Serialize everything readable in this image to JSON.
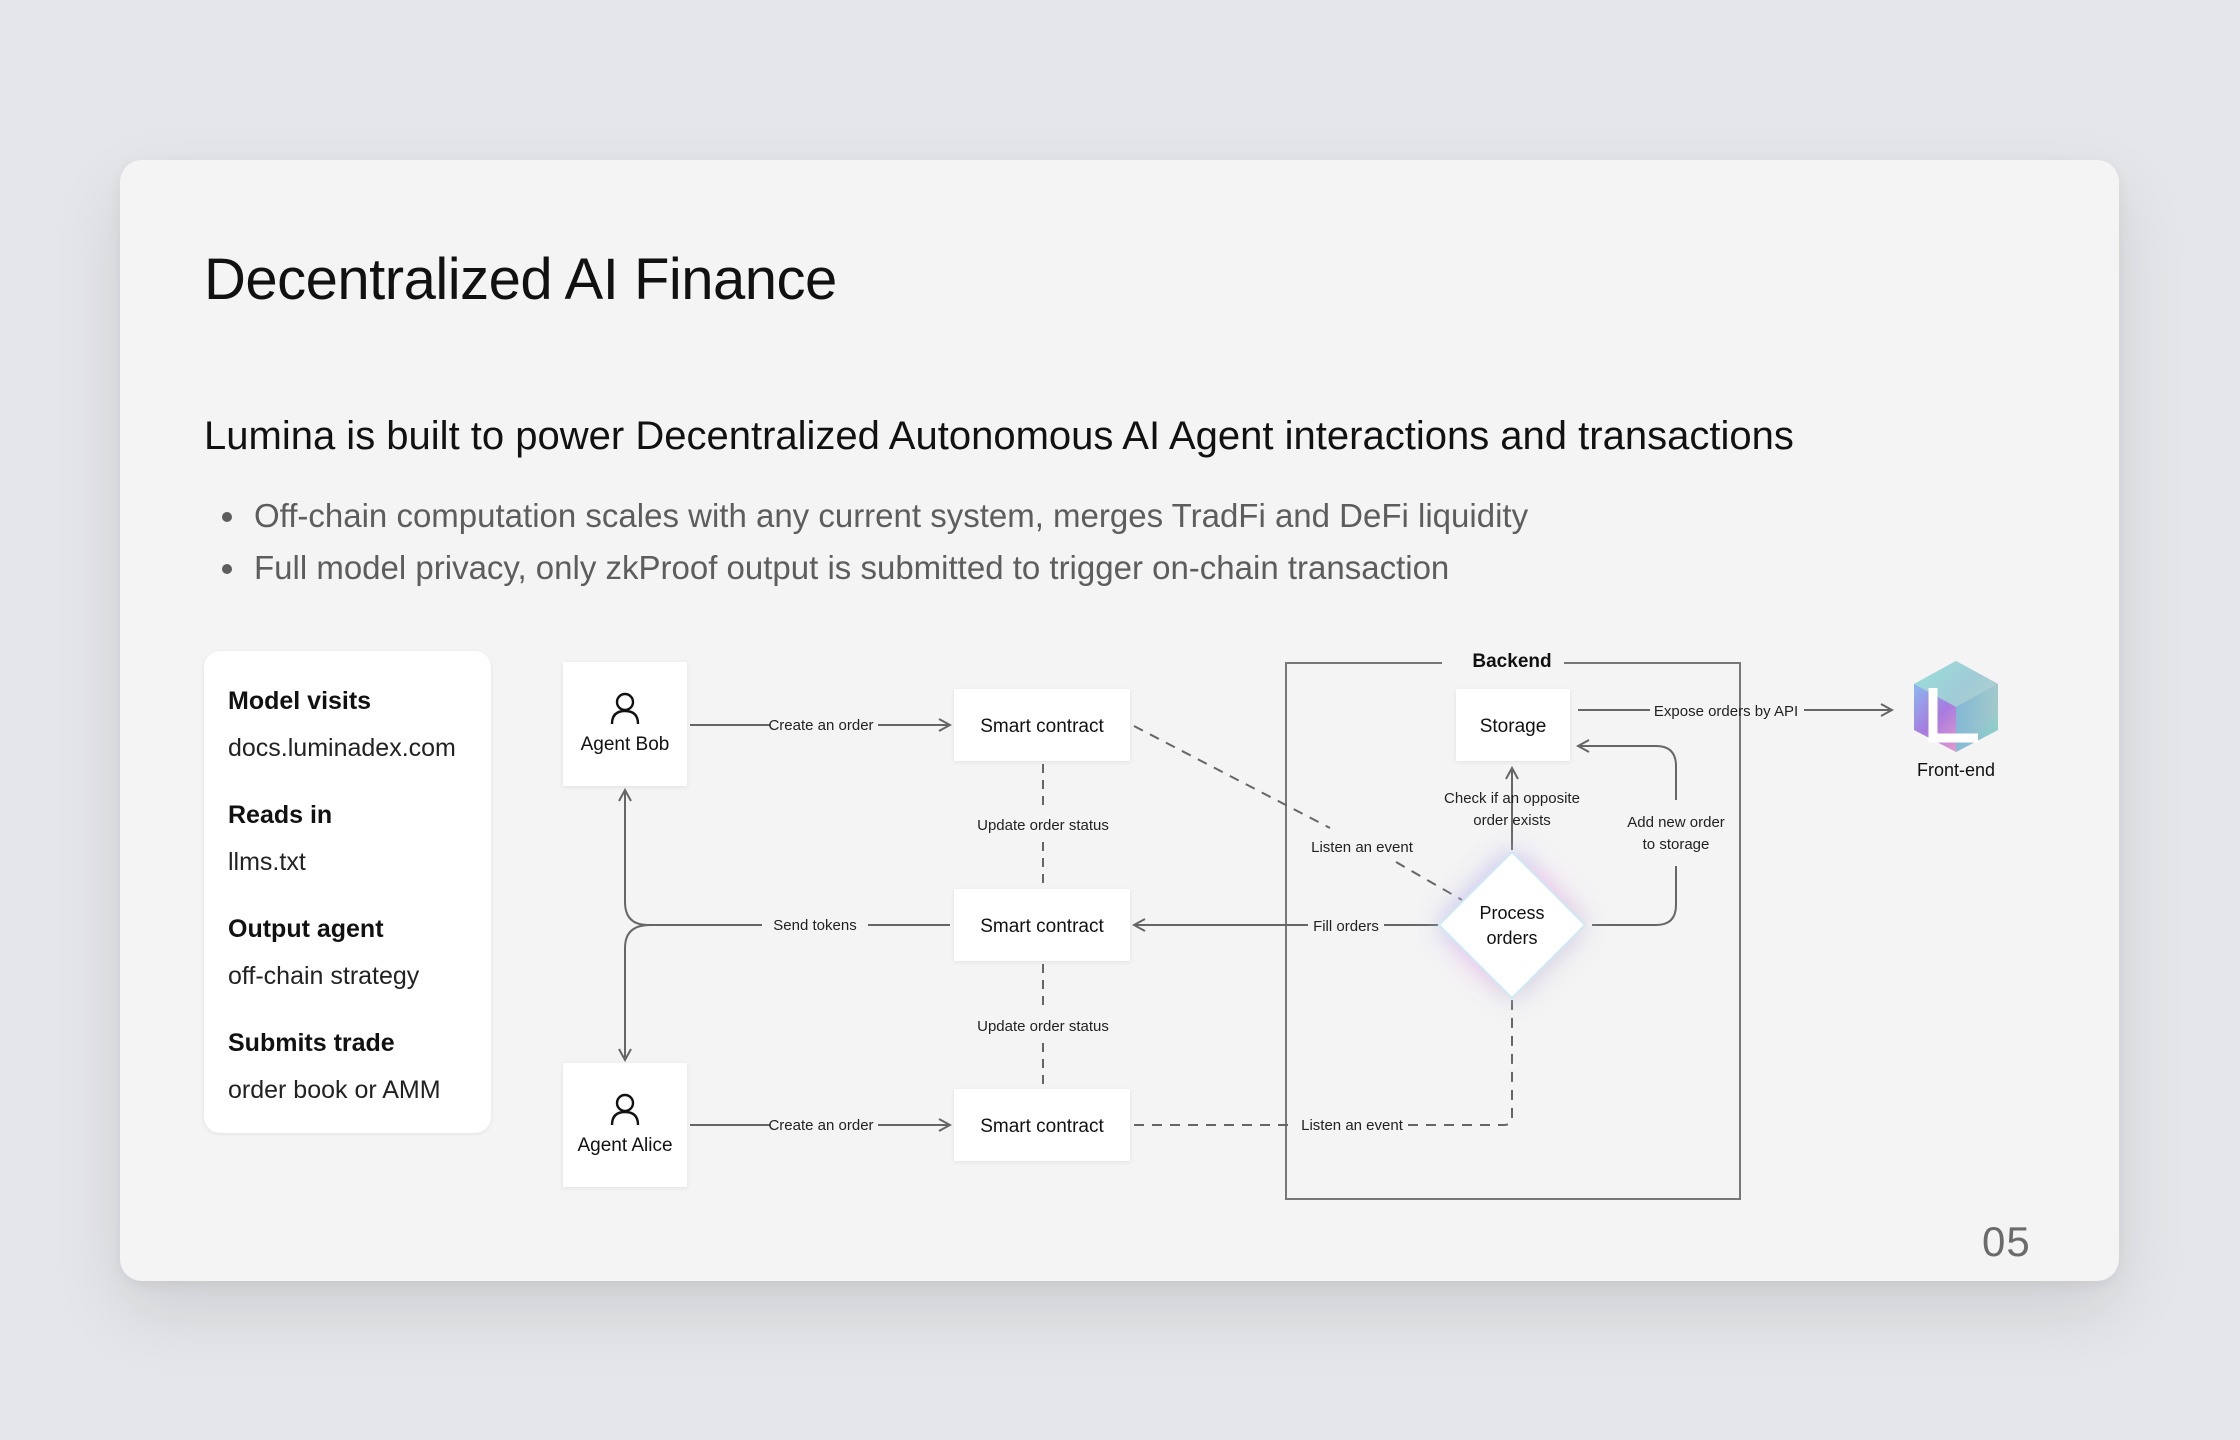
{
  "slide": {
    "title": "Decentralized AI Finance",
    "subtitle": "Lumina is built to power Decentralized Autonomous AI Agent interactions and transactions",
    "bullets": [
      "Off-chain computation scales with any current system, merges TradFi and DeFi liquidity",
      "Full model privacy, only zkProof output is submitted to trigger on-chain transaction"
    ],
    "page_number": "05"
  },
  "info_card": {
    "items": [
      {
        "heading": "Model visits",
        "value": "docs.luminadex.com"
      },
      {
        "heading": "Reads in",
        "value": "llms.txt"
      },
      {
        "heading": "Output agent",
        "value": "off-chain strategy"
      },
      {
        "heading": "Submits trade",
        "value": "order book or AMM"
      }
    ]
  },
  "diagram": {
    "nodes": {
      "agent_bob": "Agent Bob",
      "agent_alice": "Agent Alice",
      "smart_contract_top": "Smart contract",
      "smart_contract_mid": "Smart contract",
      "smart_contract_bottom": "Smart contract",
      "backend": "Backend",
      "storage": "Storage",
      "process_orders_line1": "Process",
      "process_orders_line2": "orders",
      "front_end": "Front-end"
    },
    "edges": {
      "bob_create_order": "Create an order",
      "alice_create_order": "Create an order",
      "update_status_1": "Update order status",
      "update_status_2": "Update order status",
      "send_tokens": "Send tokens",
      "fill_orders": "Fill orders",
      "listen_event_top": "Listen an event",
      "listen_event_bottom": "Listen an event",
      "check_opposite_line1": "Check if an opposite",
      "check_opposite_line2": "order exists",
      "add_new_order_line1": "Add new order",
      "add_new_order_line2": "to storage",
      "expose_api": "Expose orders by API"
    },
    "colors": {
      "line": "#666666",
      "node_fill": "#ffffff",
      "glow_blue": "#7fd3f0",
      "glow_pink": "#e9a6e6",
      "logo_green": "#6fd8b4",
      "logo_purple": "#a77be0"
    }
  }
}
